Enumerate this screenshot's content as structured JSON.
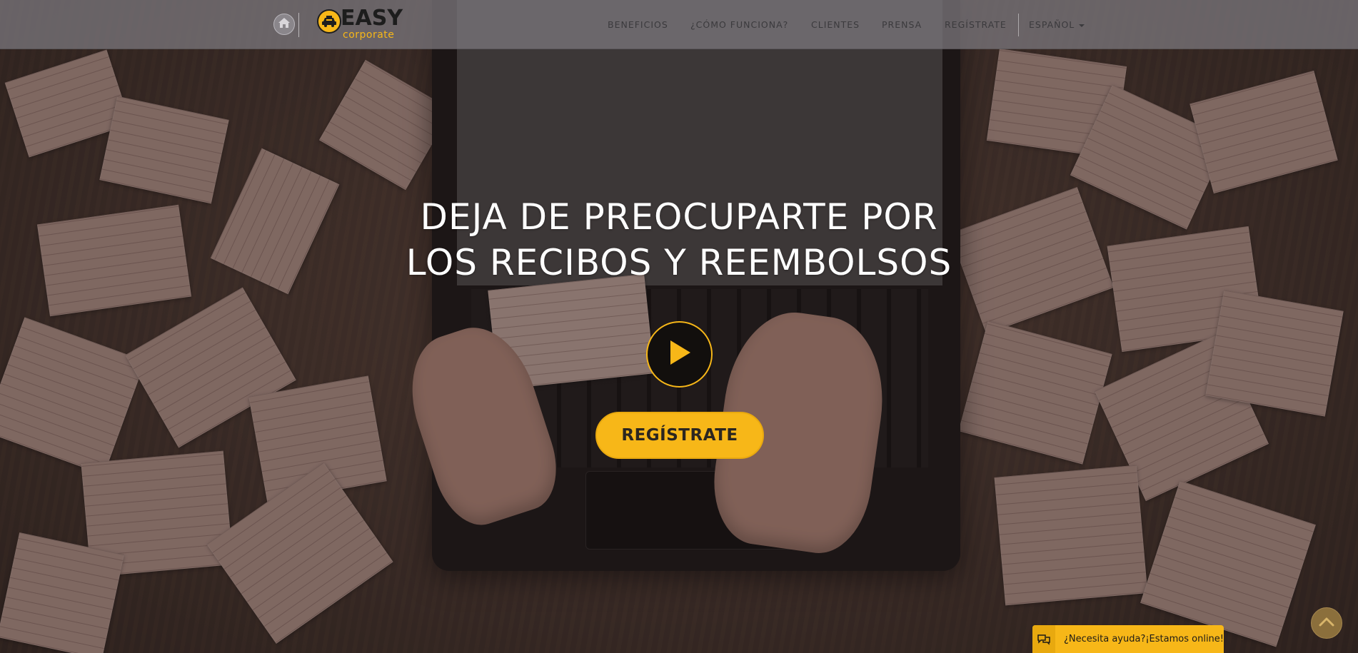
{
  "navbar": {
    "home_icon": "home-icon",
    "logo": {
      "word": "EASY",
      "sub": "corporate",
      "icon": "taxi-icon"
    },
    "links": [
      {
        "label": "BENEFICIOS"
      },
      {
        "label": "¿CÓMO FUNCIONA?"
      },
      {
        "label": "CLIENTES"
      },
      {
        "label": "PRENSA"
      },
      {
        "label": "REGÍSTRATE"
      }
    ],
    "language": {
      "label": "ESPAÑOL",
      "icon": "caret-down-icon"
    }
  },
  "hero": {
    "headline_line1": "DEJA DE PREOCUPARTE POR",
    "headline_line2": "LOS RECIBOS Y REEMBOLSOS",
    "play_icon": "play-icon",
    "cta_label": "REGÍSTRATE"
  },
  "chat": {
    "icon": "chat-bubbles-icon",
    "text": "¿Necesita ayuda?¡Estamos online!"
  },
  "back_to_top": {
    "icon": "chevron-up-icon"
  },
  "colors": {
    "accent": "#f7b718",
    "navbar_bg": "#78747a",
    "nav_text": "#3b3a3d",
    "headline": "#ffffff"
  }
}
